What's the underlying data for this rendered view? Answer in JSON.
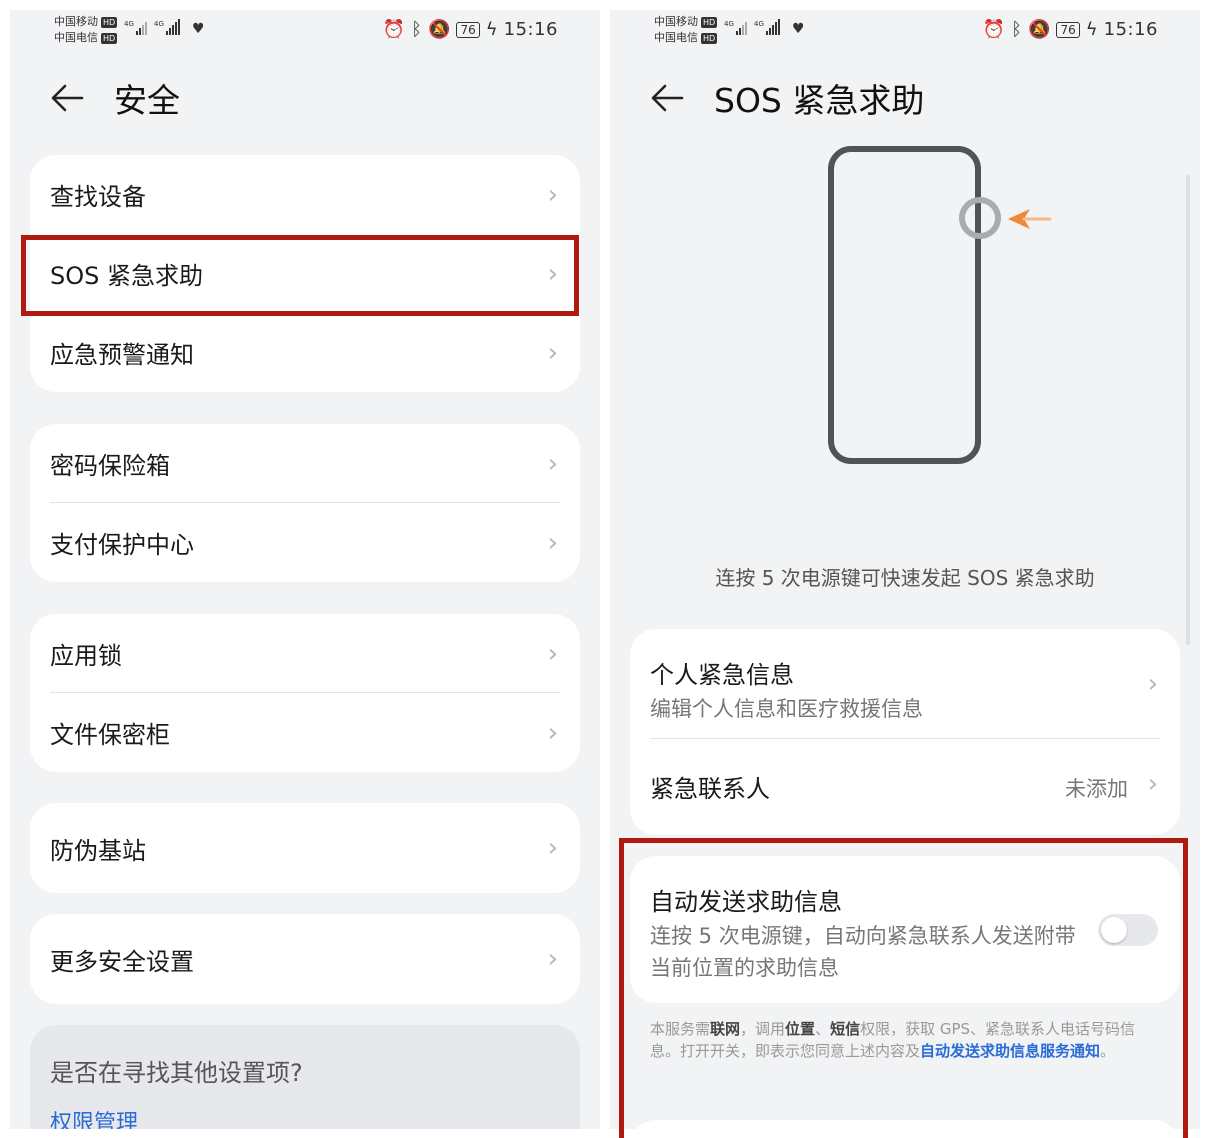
{
  "status": {
    "carrier1": "中国移动",
    "carrier2": "中国电信",
    "hd": "HD",
    "net1": "4G",
    "net2": "4G",
    "battery": "76",
    "time": "15:16"
  },
  "left": {
    "title": "安全",
    "groups": [
      [
        "查找设备",
        "SOS 紧急求助",
        "应急预警通知"
      ],
      [
        "密码保险箱",
        "支付保护中心"
      ],
      [
        "应用锁",
        "文件保密柜"
      ],
      [
        "防伪基站"
      ],
      [
        "更多安全设置"
      ]
    ],
    "search_question": "是否在寻找其他设置项?",
    "search_link": "权限管理"
  },
  "right": {
    "title": "SOS 紧急求助",
    "caption": "连按 5 次电源键可快速发起 SOS 紧急求助",
    "personal_title": "个人紧急信息",
    "personal_sub": "编辑个人信息和医疗救援信息",
    "contact_title": "紧急联系人",
    "contact_value": "未添加",
    "auto_title": "自动发送求助信息",
    "auto_desc": "连按 5 次电源键，自动向紧急联系人发送附带当前位置的求助信息",
    "auto_enabled": false,
    "notice": {
      "p1": "本服务需",
      "b1": "联网",
      "p2": "，调用",
      "b2": "位置",
      "p3": "、",
      "b3": "短信",
      "p4": "权限，获取 GPS、紧急联系人电话号码信息。打开开关，即表示您同意上述内容及",
      "link": "自动发送求助信息服务通知",
      "p5": "。"
    }
  },
  "colors": {
    "highlight": "#b1180f",
    "link": "#2a6bd6",
    "arrow": "#f0883a"
  }
}
